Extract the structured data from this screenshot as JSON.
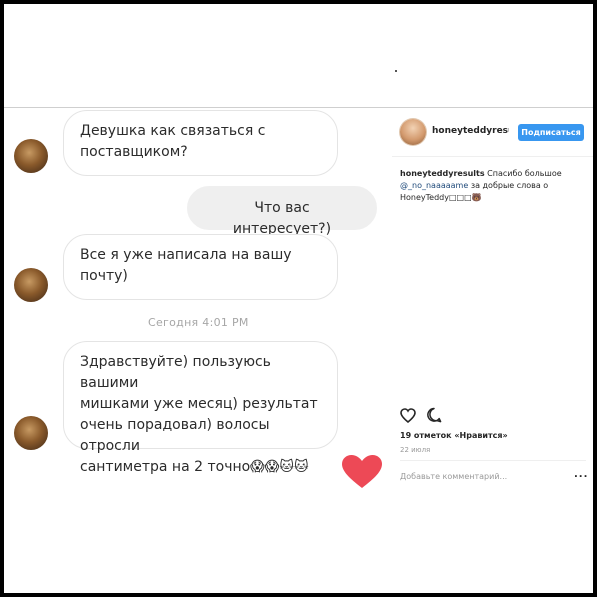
{
  "chat": {
    "messages": [
      {
        "from": "them",
        "text_lines": [
          "Девушка как связаться с",
          "поставщиком?"
        ]
      },
      {
        "from": "me",
        "text_lines": [
          "Что вас интересует?)"
        ]
      },
      {
        "from": "them",
        "text_lines": [
          "Все я уже написала на вашу",
          "почту)"
        ]
      },
      {
        "from": "them",
        "text_lines": [
          "Здравствуйте) пользуюсь вашими",
          "мишками уже месяц) результат",
          "очень порадовал) волосы отросли",
          "сантиметра на 2 точно😱😱🐱🐱"
        ]
      }
    ],
    "timestamp": "Сегодня 4:01 PM",
    "reaction_icon": "heart-icon",
    "reaction_color": "#ed4956"
  },
  "post": {
    "username": "honeyteddyresults",
    "follow_label": "Подписаться",
    "caption": {
      "username": "honeyteddyresults",
      "text_before": "Спасибо большое",
      "mention": "@_no_naaaaame",
      "text_after": "за добрые слова о HoneyTeddy□□□🐻"
    },
    "likes_text": "19 отметок «Нравится»",
    "date": "22 июля",
    "comment_placeholder": "Добавьте комментарий...",
    "more_label": "...",
    "icons": [
      "heart-outline-icon",
      "comment-icon"
    ],
    "accent": "#3897f0"
  }
}
